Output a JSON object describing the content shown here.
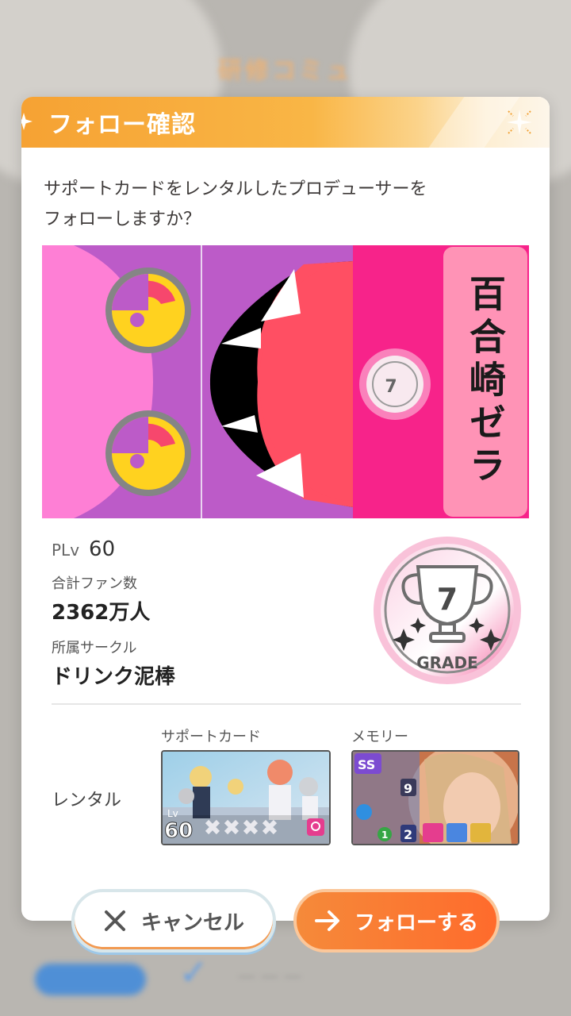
{
  "background": {
    "title": "研修コミュ"
  },
  "dialog": {
    "title": "フォロー確認",
    "message_line1": "サポートカードをレンタルしたプロデューサーを",
    "message_line2": "フォローしますか？"
  },
  "profile": {
    "name": "百合崎ゼラ",
    "plv_label": "PLv",
    "plv_value": "60",
    "fans_label": "合計ファン数",
    "fans_value": "2362万人",
    "circle_label": "所属サークル",
    "circle_value": "ドリンク泥棒",
    "grade_number": "7",
    "grade_label": "GRADE"
  },
  "rental": {
    "label": "レンタル",
    "support_card_label": "サポートカード",
    "memory_label": "メモリー",
    "support_card_level": "60",
    "memory_rank": "SS",
    "memory_badge": "9",
    "memory_stat_1": "1",
    "memory_stat_2": "2"
  },
  "buttons": {
    "cancel_label": "キャンセル",
    "follow_label": "フォローする"
  },
  "colors": {
    "header_orange": "#f6a233",
    "banner_purple": "#bc5bc8",
    "banner_pink": "#f7238a",
    "nameplate_pink": "#ff93b6",
    "follow_orange": "#ff6b2c"
  }
}
